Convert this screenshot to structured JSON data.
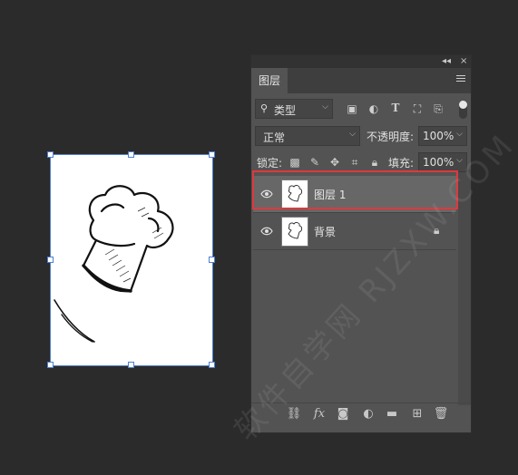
{
  "panel": {
    "collapse_icon": "double-chevron-icon",
    "close_label": "×",
    "tab_layers": "图层",
    "filter": {
      "label": "类型",
      "icon": "search-icon"
    },
    "blend_mode": "正常",
    "opacity_label": "不透明度:",
    "opacity_value": "100%",
    "lock_label": "锁定:",
    "fill_label": "填充:",
    "fill_value": "100%",
    "layers": [
      {
        "name": "图层 1",
        "selected": true,
        "visible": true
      },
      {
        "name": "背景",
        "selected": false,
        "visible": true,
        "locked": true
      }
    ],
    "footer_icons": [
      "link-icon",
      "fx-icon",
      "mask-icon",
      "adjustment-icon",
      "folder-icon",
      "new-layer-icon",
      "trash-icon"
    ],
    "fx_label": "fx"
  },
  "colors": {
    "background": "#2b2b2b",
    "panel": "#535353",
    "selected_layer": "#676767",
    "highlight": "#e0383e",
    "handle_border": "#4f7fd0"
  },
  "watermark": "软件自学网 RJZXW.COM"
}
